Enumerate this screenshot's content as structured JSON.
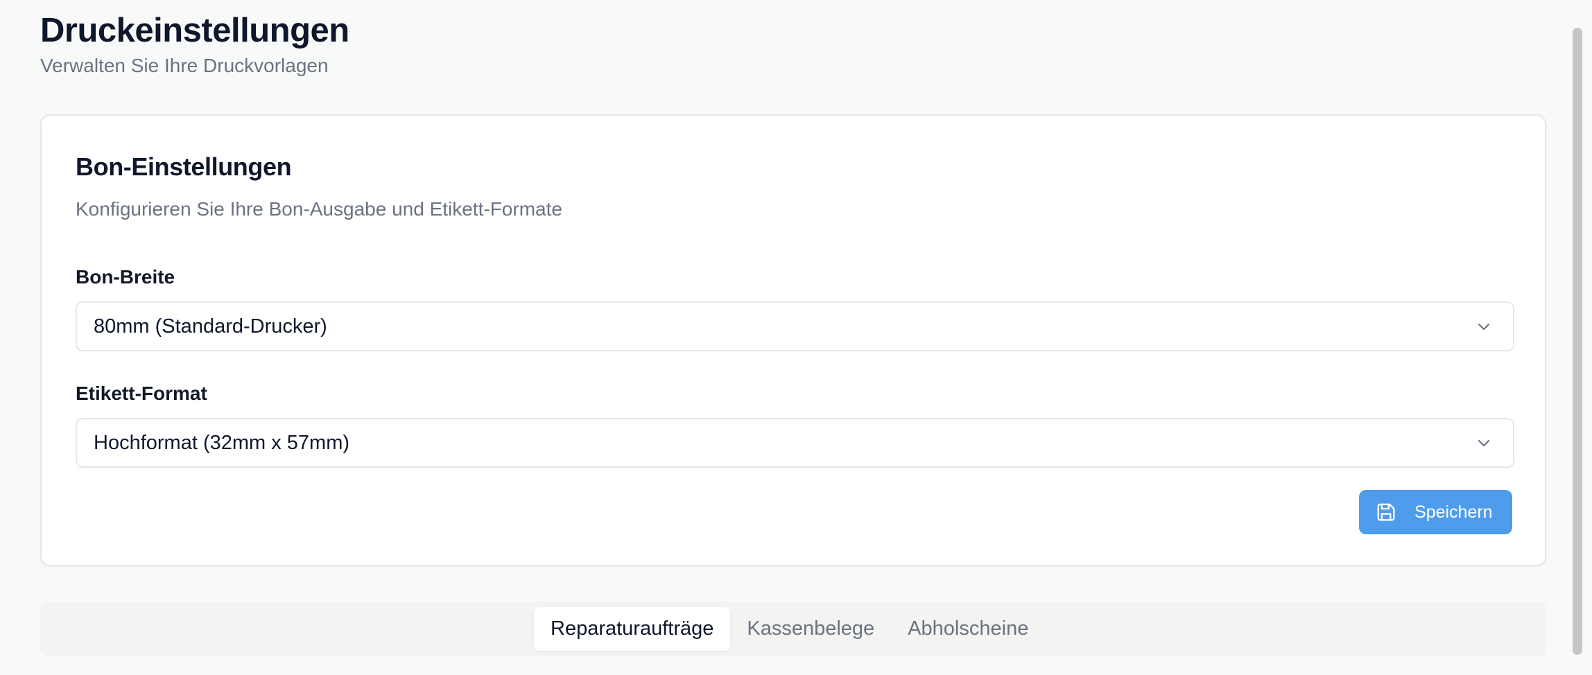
{
  "header": {
    "title": "Druckeinstellungen",
    "subtitle": "Verwalten Sie Ihre Druckvorlagen"
  },
  "card": {
    "title": "Bon-Einstellungen",
    "description": "Konfigurieren Sie Ihre Bon-Ausgabe und Etikett-Formate",
    "fields": [
      {
        "label": "Bon-Breite",
        "value": "80mm (Standard-Drucker)"
      },
      {
        "label": "Etikett-Format",
        "value": "Hochformat (32mm x 57mm)"
      }
    ],
    "save_label": "Speichern",
    "save_icon": "save-icon"
  },
  "tabs": [
    {
      "label": "Reparaturaufträge",
      "active": true
    },
    {
      "label": "Kassenbelege",
      "active": false
    },
    {
      "label": "Abholscheine",
      "active": false
    }
  ],
  "colors": {
    "accent": "#4f9cec",
    "background": "#f8f9f9",
    "text": "#0f172a",
    "muted": "#6b7280"
  }
}
